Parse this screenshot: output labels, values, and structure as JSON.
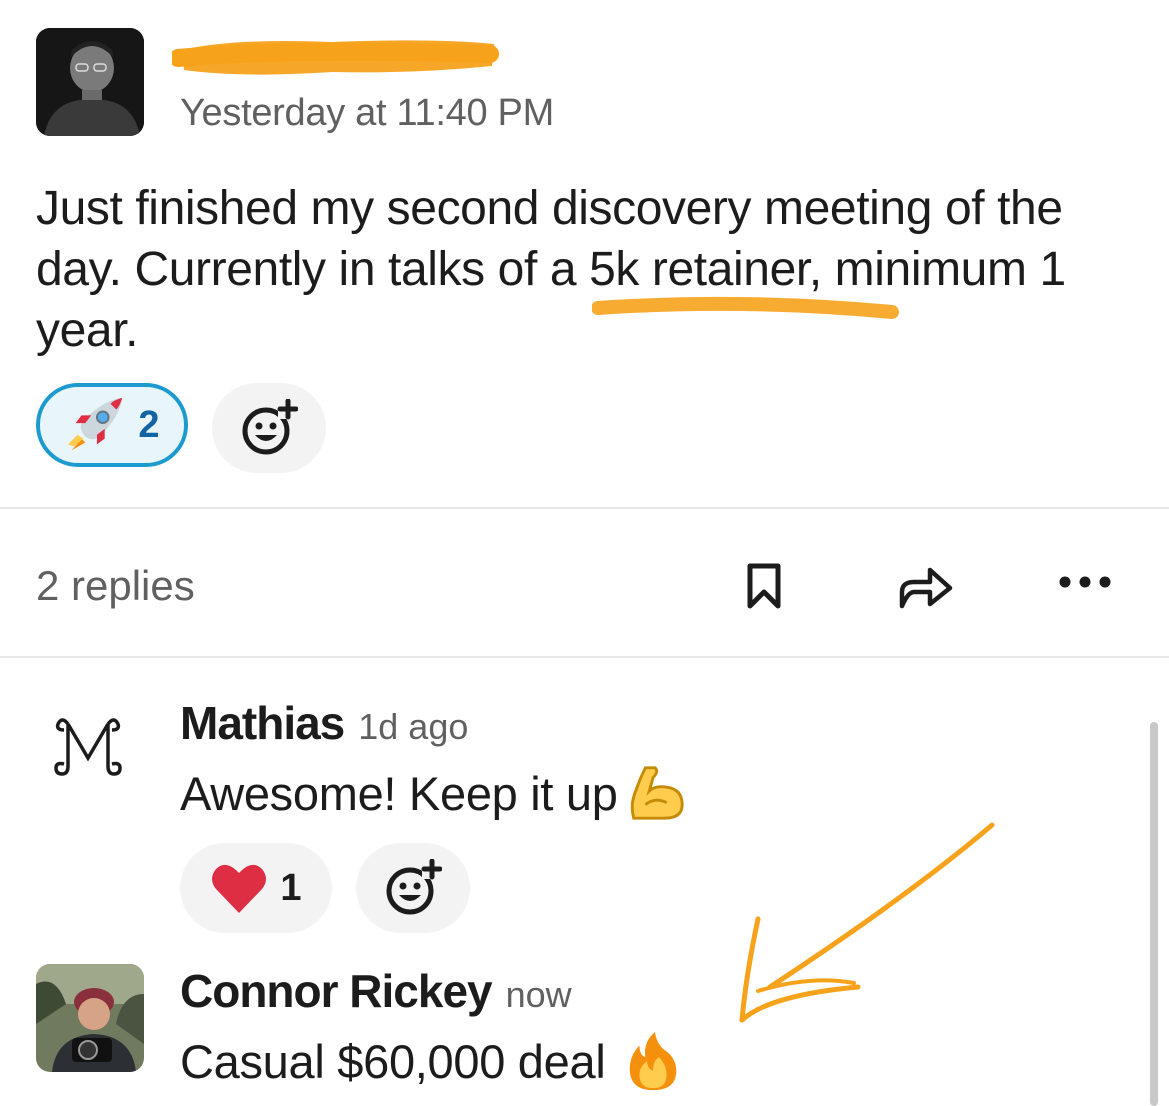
{
  "message": {
    "timestamp": "Yesterday at 11:40 PM",
    "text": "Just finished my second discovery meeting of the day. Currently in talks of a 5k retainer, minimum 1 year.",
    "reactions": [
      {
        "emoji": "rocket-emoji",
        "count": "2",
        "selected": true
      }
    ],
    "add_reaction_icon": "add-emoji-icon"
  },
  "thread_bar": {
    "replies_label": "2 replies",
    "icons": [
      "bookmark-icon",
      "share-arrow-icon",
      "more-icon"
    ]
  },
  "replies": [
    {
      "author": "Mathias",
      "time": "1d ago",
      "text": "Awesome! Keep it up",
      "emoji": "flexed-biceps-emoji",
      "reactions": [
        {
          "emoji": "red-heart-emoji",
          "count": "1"
        }
      ]
    },
    {
      "author": "Connor Rickey",
      "time": "now",
      "text": "Casual $60,000 deal",
      "emoji": "fire-emoji"
    }
  ],
  "colors": {
    "annotation_orange": "#f7a21b",
    "selected_reaction_border": "#1d9bd1",
    "selected_reaction_bg": "#e8f5fa",
    "secondary_text": "#616061"
  }
}
